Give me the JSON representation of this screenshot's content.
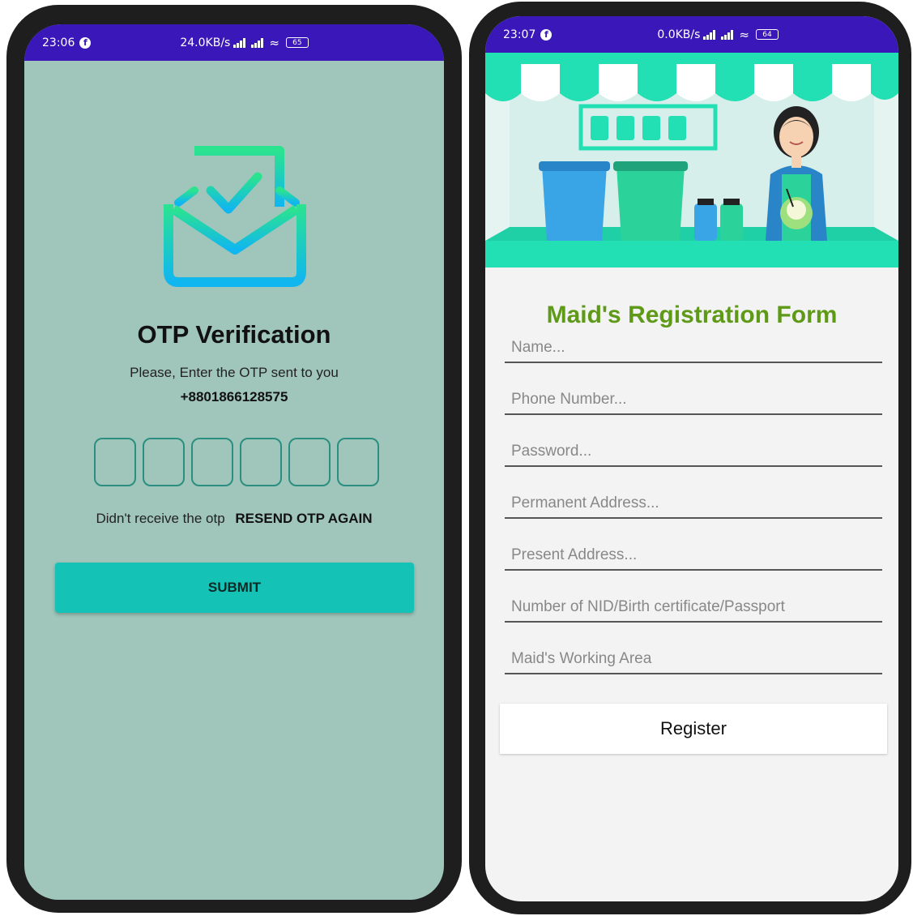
{
  "left_screen": {
    "statusbar": {
      "time": "23:06",
      "network_speed": "24.0KB/s",
      "battery": "65"
    },
    "title": "OTP Verification",
    "description": "Please, Enter the OTP sent to you",
    "phone_number": "+8801866128575",
    "otp_digits": [
      "",
      "",
      "",
      "",
      "",
      ""
    ],
    "resend_prompt": "Didn't receive the otp",
    "resend_link": "RESEND OTP AGAIN",
    "submit_label": "SUBMIT",
    "background_color": "#a0c5ba",
    "accent_color": "#14c2b6",
    "icon": "mail-check-icon"
  },
  "right_screen": {
    "statusbar": {
      "time": "23:07",
      "network_speed": "0.0KB/s",
      "battery": "64"
    },
    "title": "Maid's Registration Form",
    "title_color": "#5e9a18",
    "fields": {
      "name": "Name...",
      "phone": "Phone Number...",
      "password": "Password...",
      "permanent_address": "Permanent Address...",
      "present_address": "Present Address...",
      "nid": "Number of NID/Birth certificate/Passport",
      "working_area": "Maid's Working Area"
    },
    "register_label": "Register",
    "illustration": "shop-counter-illustration"
  }
}
